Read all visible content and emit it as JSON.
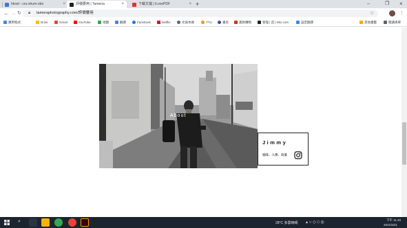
{
  "browser": {
    "tabs": [
      {
        "title": "hkset - cru-shum-obo",
        "close": "×"
      },
      {
        "title": "評價要用 | Tameria",
        "close": "×"
      },
      {
        "title": "下載文檔 | iLovePDF",
        "close": "×"
      }
    ],
    "new_tab": "+",
    "window": {
      "minimize": "–",
      "maximize": "❐",
      "close": "×"
    },
    "back": "←",
    "forward": "→",
    "reload": "↻",
    "url": "tameraphotography.com/評價要用",
    "star": "☆",
    "menu": "⋮",
    "bookmarks": [
      "應用程式",
      "Drive",
      "Gmail",
      "YouTube",
      "地圖",
      "翻譯",
      "Facebook",
      "Netflix",
      "文與木頭",
      "TTU",
      "書房",
      "貨款購物",
      "管理 | 首 | Wix.com",
      "設定翻譯"
    ],
    "bookmarks_right": [
      "其他書籤",
      "閱讀清單"
    ]
  },
  "page": {
    "photo_caption": "About",
    "card": {
      "name": "Jimmy",
      "tags": "咖啡、人像、商業"
    },
    "icons": {
      "instagram": "instagram-icon"
    }
  },
  "taskbar": {
    "weather": "28°C 多雲時晴",
    "time": "下午 11:40",
    "date": "2021/5/21"
  },
  "colors": {
    "tabstrip": "#dee1e6",
    "taskbar": "#1c2430"
  }
}
